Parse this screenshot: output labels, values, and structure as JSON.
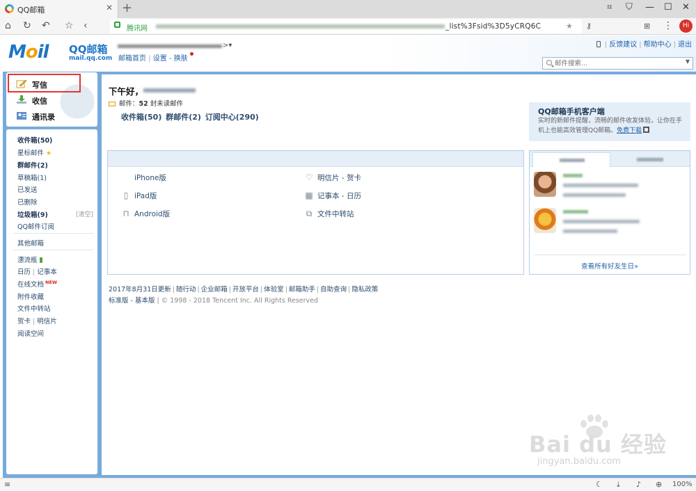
{
  "browser": {
    "tab_title": "QQ邮箱",
    "tab_close": "✕",
    "new_tab": "+",
    "site_label": "腾讯网",
    "url_tail": "_list%3Fsid%3D5yCRQ6C",
    "zoom": "100%",
    "profile_avatar": "Hi"
  },
  "header": {
    "logo_text": "Mail",
    "logo_cn": "QQ邮箱",
    "logo_domain": "mail.qq.com",
    "account_links": [
      "邮箱首页",
      "设置",
      "换肤"
    ],
    "top_links": [
      "反馈建议",
      "帮助中心",
      "退出"
    ],
    "search_placeholder": "邮件搜索..."
  },
  "quick_actions": [
    {
      "label": "写信",
      "icon": "pencil-icon"
    },
    {
      "label": "收信",
      "icon": "inbox-download-icon"
    },
    {
      "label": "通讯录",
      "icon": "contacts-icon"
    }
  ],
  "folders": {
    "inbox": "收件箱(50)",
    "starred": "星标邮件",
    "group": "群邮件(2)",
    "drafts": "草稿箱(1)",
    "sent": "已发送",
    "deleted": "已删除",
    "spam": "垃圾箱(9)",
    "spam_clear": "[清空]",
    "subscriptions": "QQ邮件订阅",
    "other_mailbox": "其他邮箱",
    "drift_bottle": "漂流瓶",
    "calendar": "日历",
    "notes": "记事本",
    "online_docs": "在线文档",
    "new_badge": "NEW",
    "attachments": "附件收藏",
    "file_transfer": "文件中转站",
    "greeting_cards": "贺卡",
    "postcards": "明信片",
    "reading_space": "阅读空间"
  },
  "main": {
    "greeting": "下午好，",
    "mail_count_label": "邮件：",
    "mail_count": "52",
    "mail_count_suffix": " 封未读邮件",
    "quick_folders": [
      "收件箱(50)",
      "群邮件(2)",
      "订阅中心(290)"
    ],
    "apps": [
      {
        "label": "iPhone版",
        "icon": "apple-icon"
      },
      {
        "label": "iPad版",
        "icon": "tablet-icon"
      },
      {
        "label": "Android版",
        "icon": "android-icon"
      },
      {
        "label": "明信片 - 贺卡",
        "icon": "heart-icon"
      },
      {
        "label": "记事本 - 日历",
        "icon": "calendar-icon"
      },
      {
        "label": "文件中转站",
        "icon": "file-transfer-icon"
      }
    ],
    "promo": {
      "title": "QQ邮箱手机客户端",
      "body": "实时的新邮件提醒，流畅的邮件收发体验，让你在手机上也能高效管理QQ邮箱。",
      "link": "免费下载"
    },
    "birthday_link": "查看所有好友生日»",
    "footer_links": [
      "2017年8月31日更新",
      "随行动",
      "企业邮箱",
      "开放平台",
      "体验室",
      "邮箱助手",
      "自助查询",
      "隐私政策"
    ],
    "footer_version": "标准版 - 基本版",
    "footer_copy": " | © 1998 - 2018 Tencent Inc. All Rights Reserved"
  },
  "watermark": {
    "text": "Bai du 经验",
    "url": "jingyan.baidu.com"
  },
  "colors": {
    "brand_blue": "#1e76c5",
    "frame_blue": "#77aadb",
    "highlight_red": "#e8332f"
  }
}
